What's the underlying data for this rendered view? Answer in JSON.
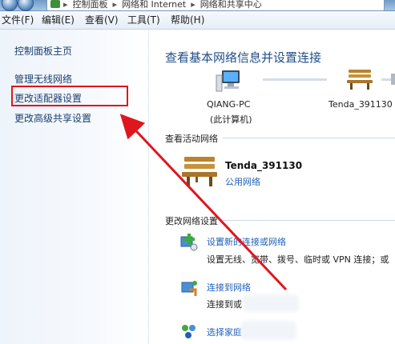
{
  "address_bar": {
    "crumbs": [
      "控制面板",
      "网络和 Internet",
      "网络和共享中心"
    ]
  },
  "menu": {
    "items": [
      "文件(F)",
      "编辑(E)",
      "查看(V)",
      "工具(T)",
      "帮助(H)"
    ]
  },
  "sidebar": {
    "items": [
      "控制面板主页",
      "管理无线网络",
      "更改适配器设置",
      "更改高级共享设置"
    ]
  },
  "main": {
    "title": "查看基本网络信息并设置连接",
    "computer_name": "QIANG-PC",
    "computer_sub": "(此计算机)",
    "network_map_name": "Tenda_391130",
    "active_networks_label": "查看活动网络",
    "active_network": {
      "name": "Tenda_391130",
      "type": "公用网络"
    },
    "change_settings_label": "更改网络设置",
    "tasks": [
      {
        "link": "设置新的连接或网络",
        "desc": "设置无线、宽带、拨号、临时或 VPN 连接；或"
      },
      {
        "link": "连接到网络",
        "desc": "连接到或"
      },
      {
        "link": "选择家庭",
        "desc": ""
      }
    ]
  },
  "colors": {
    "accent_link": "#1f5fb8",
    "highlight": "#e0161e",
    "title_blue": "#1f4d87"
  }
}
